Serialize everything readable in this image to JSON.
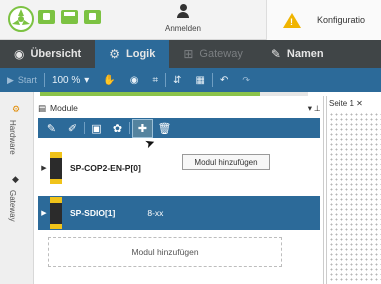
{
  "topbar": {
    "login_label": "Anmelden",
    "config_label": "Konfiguratio",
    "warning_glyph": "!"
  },
  "nav": {
    "tabs": [
      {
        "label": "Übersicht",
        "icon": "eye-icon",
        "state": "normal"
      },
      {
        "label": "Logik",
        "icon": "logic-icon",
        "state": "active"
      },
      {
        "label": "Gateway",
        "icon": "gateway-icon",
        "state": "disabled"
      },
      {
        "label": "Namen",
        "icon": "pencil-icon",
        "state": "normal"
      }
    ]
  },
  "toolbar": {
    "start_label": "Start",
    "zoom": "100 %",
    "zoom_caret": "▾"
  },
  "progress": {
    "fraction": 0.82
  },
  "siderail": {
    "hardware_label": "Hardware",
    "gateway_label": "Gateway"
  },
  "module_panel": {
    "title": "Module",
    "pin": "▾ ⟂",
    "tooltip": "Modul hinzufügen",
    "modules": [
      {
        "name": "SP-COP2-EN-P[0]",
        "info": ""
      },
      {
        "name": "SP-SDIO[1]",
        "info": "8-xx"
      }
    ],
    "add_label": "Modul hinzufügen"
  },
  "page_panel": {
    "tab_label": "Seite 1",
    "close": "✕"
  },
  "colors": {
    "accent_blue": "#2c6a99",
    "nav_dark": "#404547",
    "brand_green": "#7cc242",
    "warning": "#f0b400",
    "device_yellow": "#f0c31a"
  }
}
